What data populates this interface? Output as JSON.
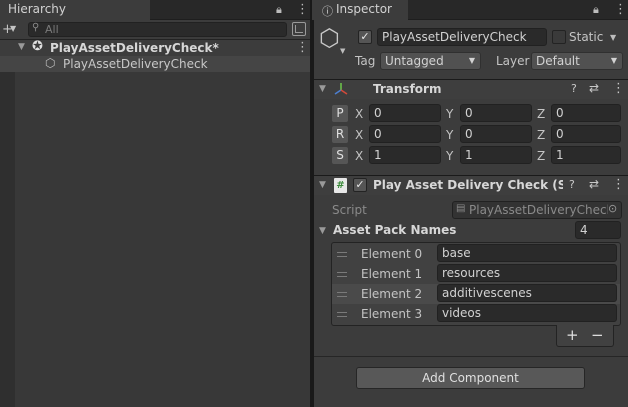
{
  "hierarchy": {
    "tab_title": "Hierarchy",
    "search_placeholder": "All",
    "scene_name": "PlayAssetDeliveryCheck*",
    "object_name": "PlayAssetDeliveryCheck"
  },
  "inspector": {
    "tab_title": "Inspector",
    "object_name": "PlayAssetDeliveryCheck",
    "static_label": "Static",
    "tag_label": "Tag",
    "tag_value": "Untagged",
    "layer_label": "Layer",
    "layer_value": "Default",
    "transform": {
      "title": "Transform",
      "rows": [
        {
          "label": "P",
          "x": "0",
          "y": "0",
          "z": "0"
        },
        {
          "label": "R",
          "x": "0",
          "y": "0",
          "z": "0"
        },
        {
          "label": "S",
          "x": "1",
          "y": "1",
          "z": "1"
        }
      ],
      "axis_x": "X",
      "axis_y": "Y",
      "axis_z": "Z"
    },
    "script_component": {
      "title": "Play Asset Delivery Check (Scrip",
      "script_label": "Script",
      "script_value": "PlayAssetDeliveryCheck",
      "list_label": "Asset Pack Names",
      "list_count": "4",
      "elements": [
        {
          "label": "Element 0",
          "value": "base"
        },
        {
          "label": "Element 1",
          "value": "resources"
        },
        {
          "label": "Element 2",
          "value": "additivescenes"
        },
        {
          "label": "Element 3",
          "value": "videos"
        }
      ],
      "add_symbol": "+",
      "remove_symbol": "−"
    },
    "add_component_label": "Add Component"
  },
  "colors": {
    "accent_blue": "#4c7fd0",
    "background": "#383838",
    "panel": "#3c3c3c"
  }
}
